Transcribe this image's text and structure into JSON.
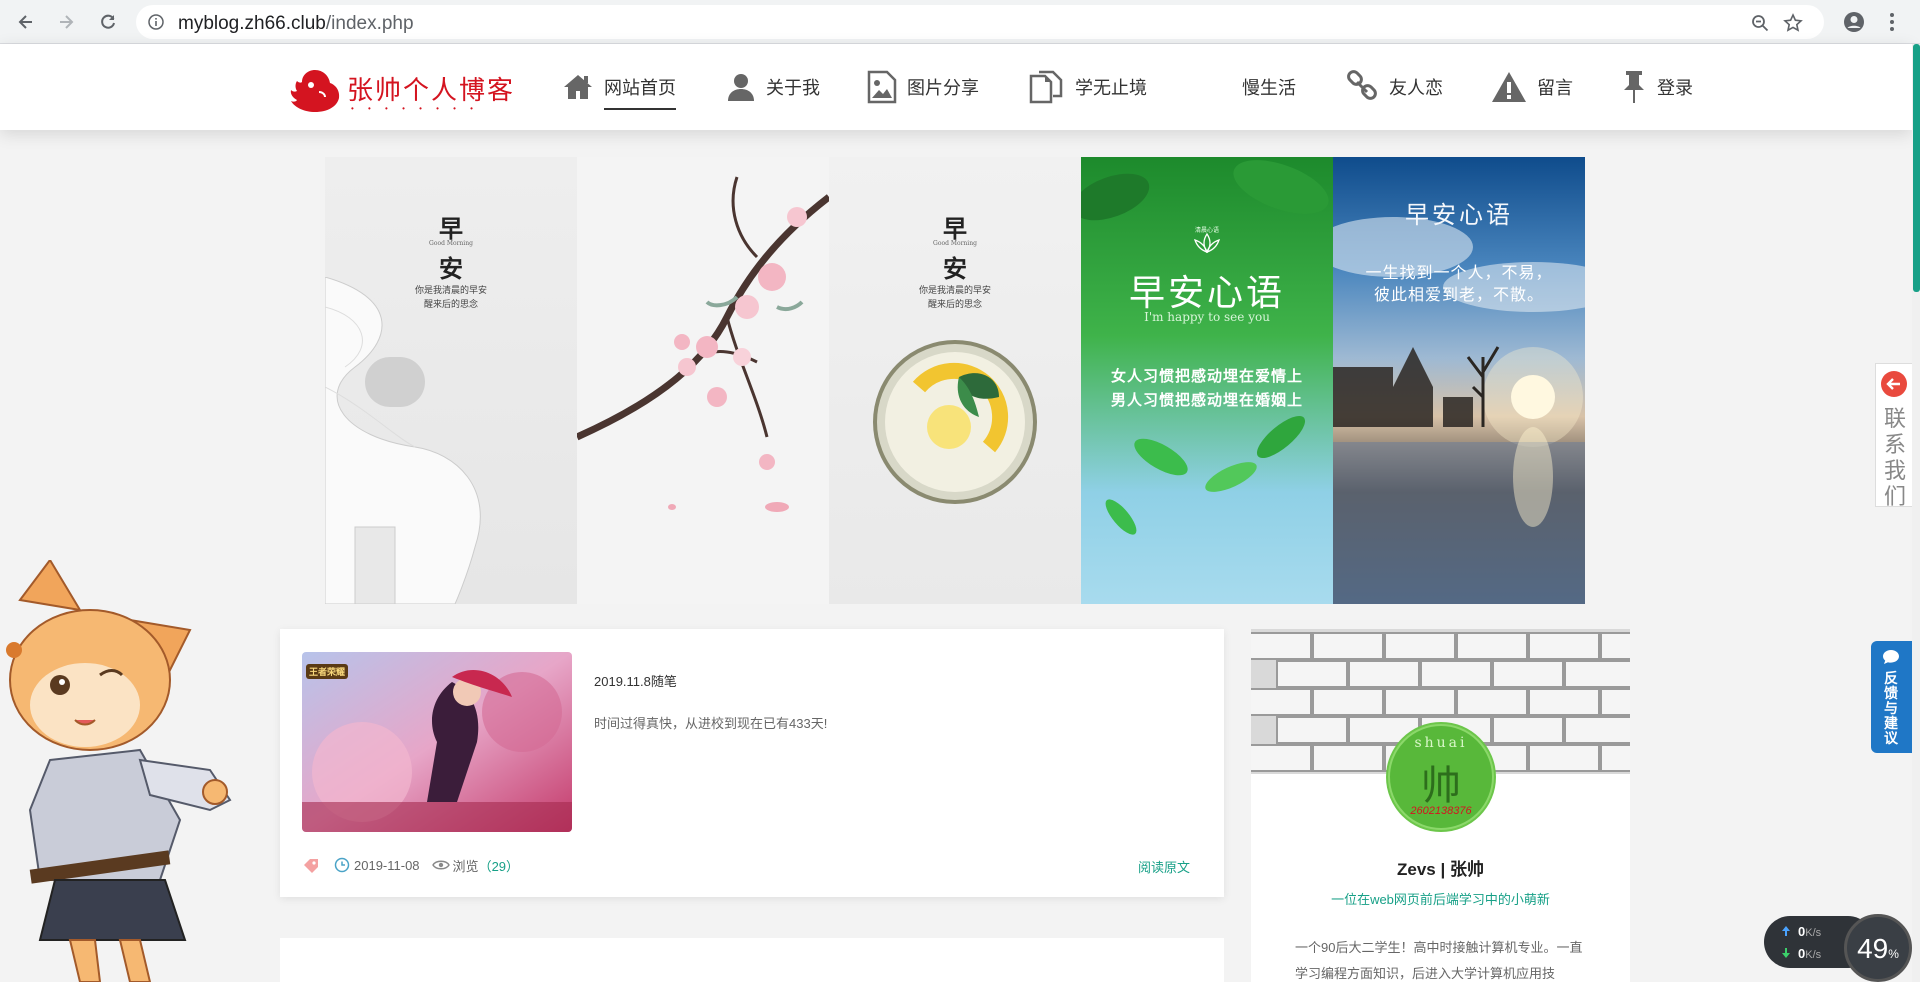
{
  "browser": {
    "url_host": "myblog.zh66.club",
    "url_path": "/index.php"
  },
  "site": {
    "logo_text": "张帅个人博客",
    "logo_dots": "• • • • • • • •",
    "nav": [
      {
        "label": "网站首页",
        "icon": "home-icon",
        "active": true
      },
      {
        "label": "关于我",
        "icon": "user-icon"
      },
      {
        "label": "图片分享",
        "icon": "image-icon"
      },
      {
        "label": "学无止境",
        "icon": "copy-icon"
      },
      {
        "label": "慢生活",
        "icon": ""
      },
      {
        "label": "友人恋",
        "icon": "link-icon"
      },
      {
        "label": "留言",
        "icon": "warning-icon"
      },
      {
        "label": "登录",
        "icon": "pin-icon"
      }
    ]
  },
  "banner": {
    "panel1": {
      "char1": "早",
      "en": "Good Morning",
      "char2": "安",
      "line1": "你是我清晨的早安",
      "line2": "醒来后的思念"
    },
    "panel3": {
      "char1": "早",
      "en": "Good Morning",
      "char2": "安",
      "line1": "你是我清晨的早安",
      "line2": "醒来后的思念"
    },
    "panel4": {
      "top": "清晨心语",
      "title": "早安心语",
      "en": "I'm happy to see you",
      "line1": "女人习惯把感动埋在爱情上",
      "line2": "男人习惯把感动埋在婚姻上"
    },
    "panel5": {
      "title": "早安心语",
      "line1": "一生找到一个人，不易，",
      "line2": "彼此相爱到老，不散。"
    }
  },
  "post": {
    "title": "2019.11.8随笔",
    "excerpt": "时间过得真快，从进校到现在已有433天!",
    "date": "2019-11-08",
    "views_label": "浏览",
    "views_count": "（29）",
    "read_more": "阅读原文",
    "thumb_badge": "王者荣耀"
  },
  "profile": {
    "name": "Zevs | 张帅",
    "subtitle": "一位在web网页前后端学习中的小萌新",
    "desc": "一个90后大二学生！高中时接触计算机专业。一直学习编程方面知识，后进入大学计算机应用技",
    "avatar_top": "shuai",
    "avatar_char": "帅",
    "avatar_bottom": "2602138376"
  },
  "widgets": {
    "contact": "联系我们",
    "feedback": "反馈与建议",
    "upload_speed": "0",
    "download_speed": "0",
    "speed_unit": "K/s",
    "percent": "49",
    "percent_unit": "%"
  },
  "colors": {
    "accent": "#17a087",
    "logo": "#d41420",
    "feedback": "#1f77c6"
  }
}
